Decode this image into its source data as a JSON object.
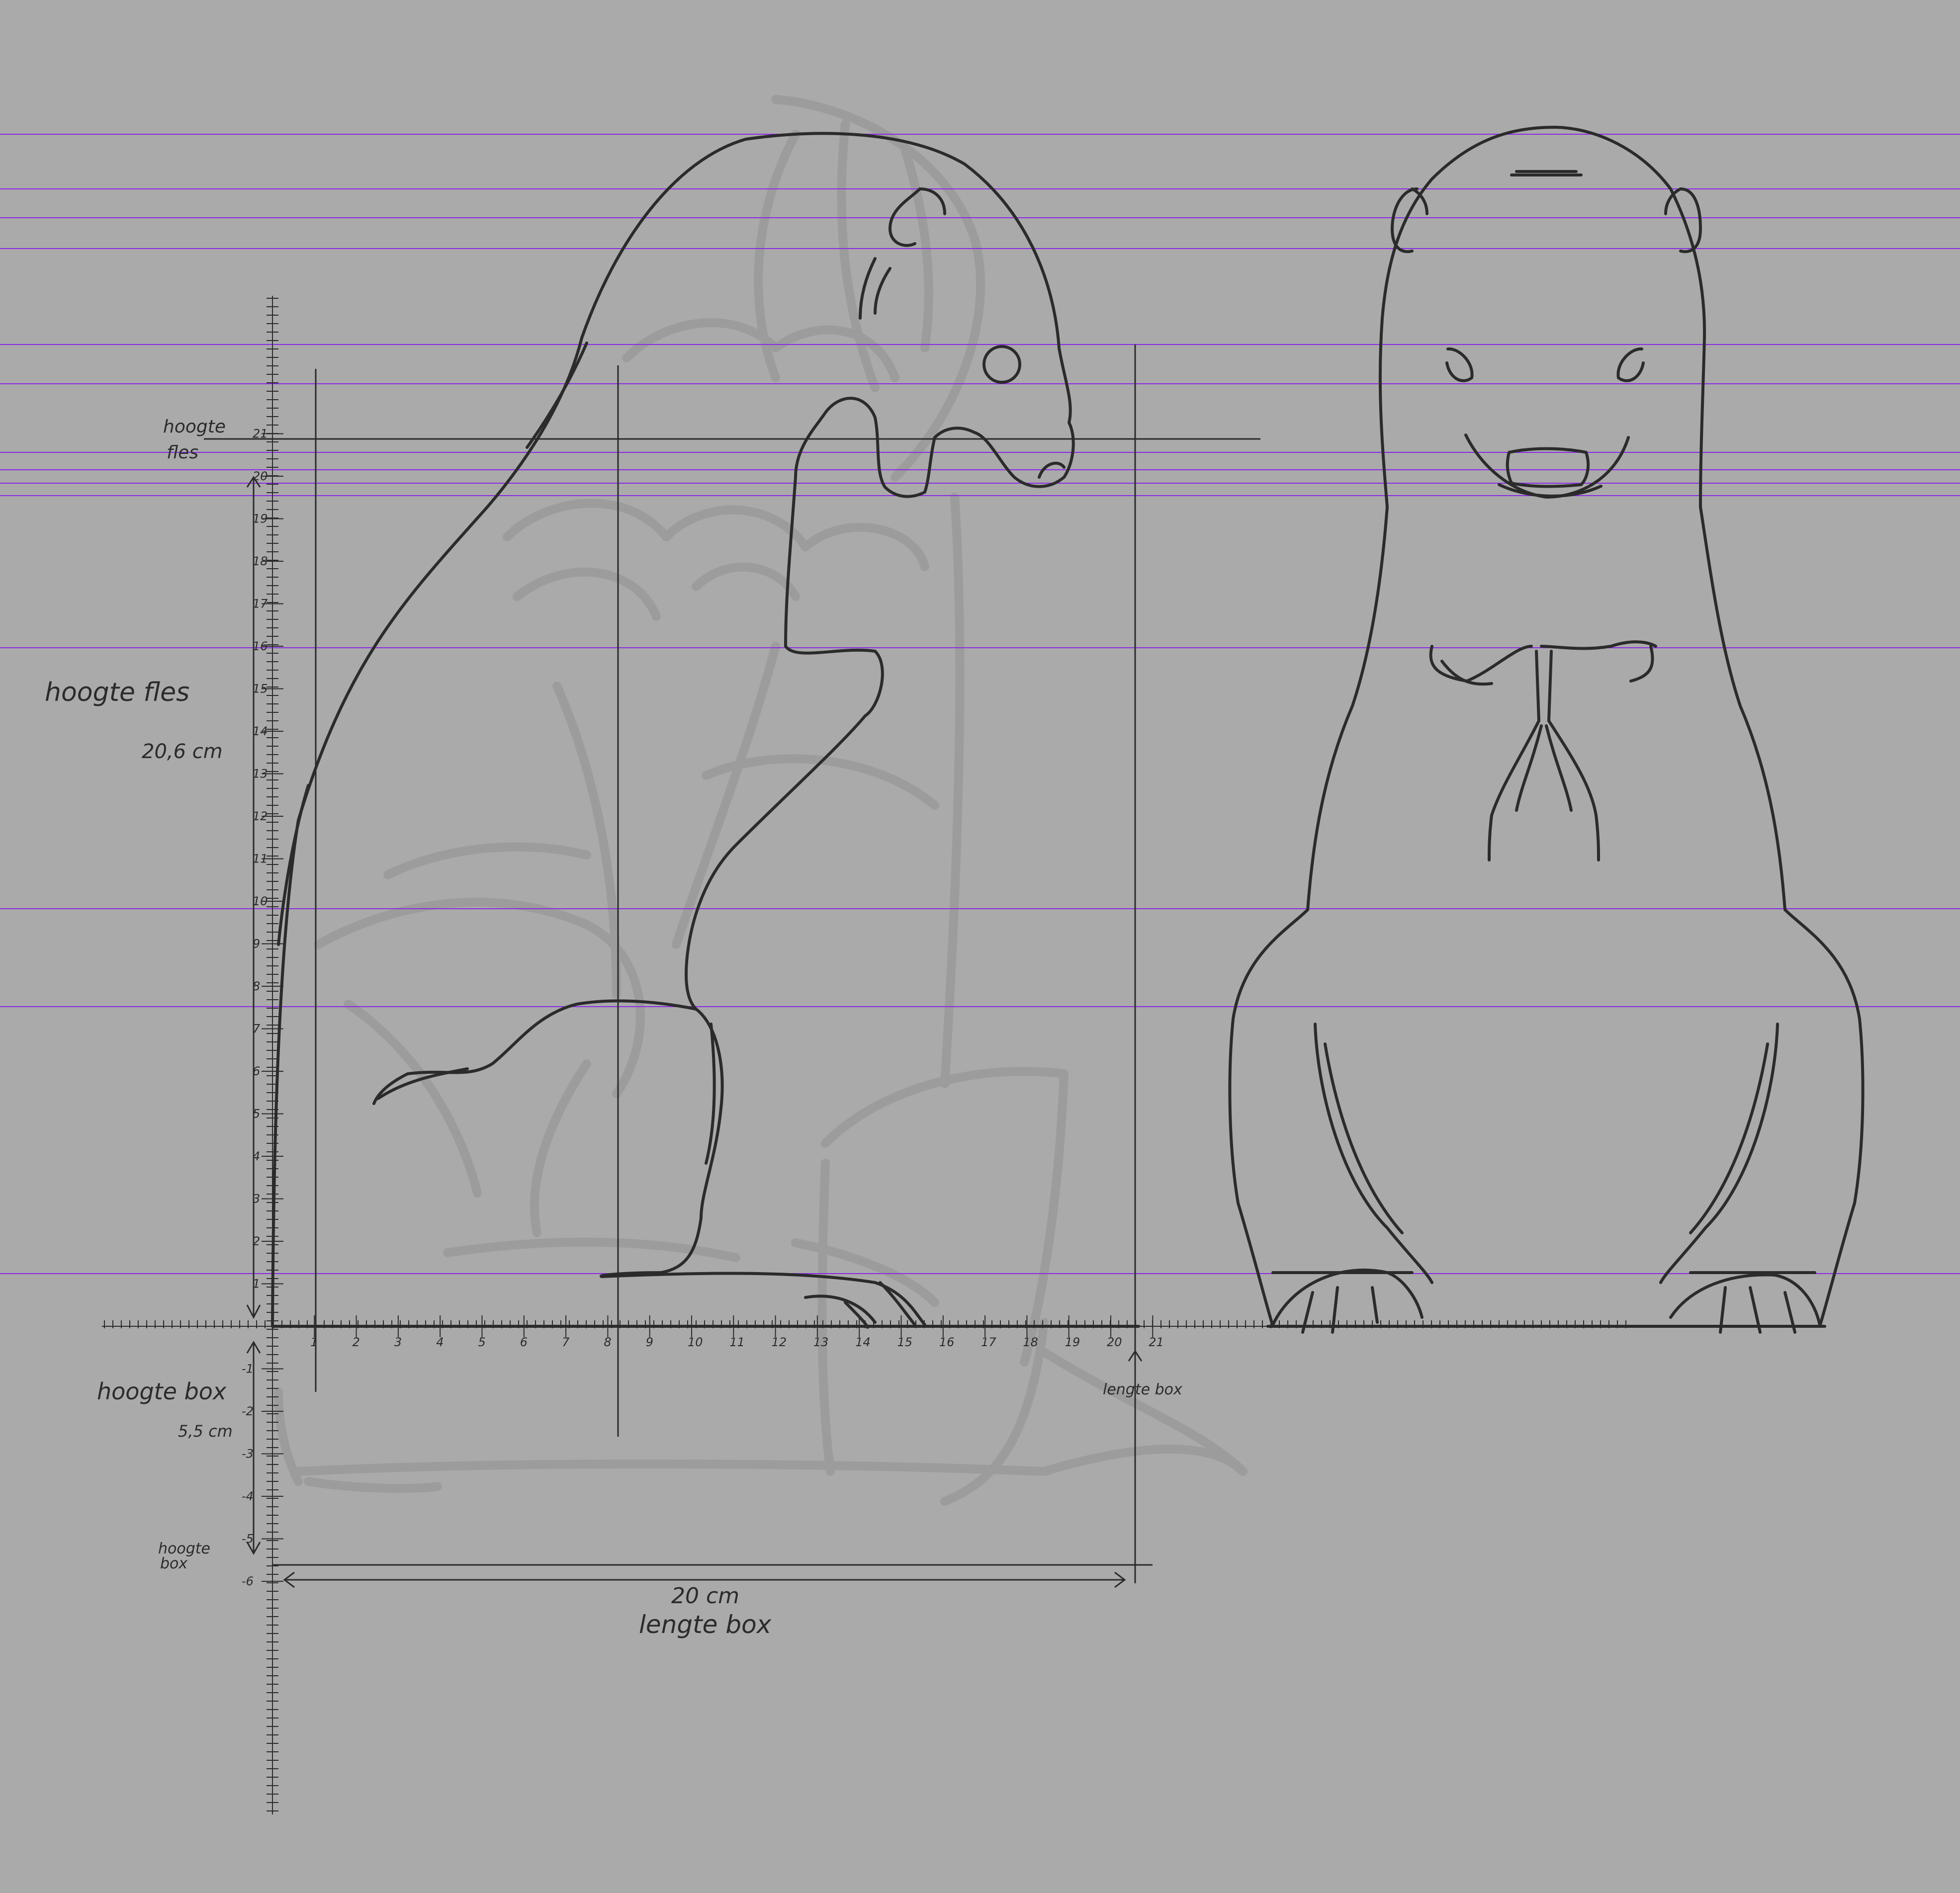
{
  "colors": {
    "background": "#aaaaaa",
    "guide_line": "#8a2be2",
    "ink": "#2b2b2b",
    "ghost_sketch": "#9a9a9a"
  },
  "labels": {
    "bottle_height_left": "hoogte fles",
    "bottle_height_value": "20,6 cm",
    "bottle_height_marker_line1": "hoogte",
    "bottle_height_marker_line2": "fles",
    "box_height": "hoogte box",
    "box_height_value": "5,5 cm",
    "box_height_marker_line1": "hoogte",
    "box_height_marker_line2": "box",
    "box_length_marker": "lengte box",
    "box_length_value": "20 cm",
    "box_length_label": "lengte box"
  },
  "ruler": {
    "unit": "cm",
    "vertical_ticks": [
      "21",
      "20",
      "19",
      "18",
      "17",
      "16",
      "15",
      "14",
      "13",
      "12",
      "11",
      "10",
      "9",
      "8",
      "7",
      "6",
      "5",
      "4",
      "3",
      "2",
      "1",
      "-1",
      "-2",
      "-3",
      "-4",
      "-5",
      "-6"
    ],
    "horizontal_ticks": [
      "1",
      "2",
      "3",
      "4",
      "5",
      "6",
      "7",
      "8",
      "9",
      "10",
      "11",
      "12",
      "13",
      "14",
      "15",
      "16",
      "17",
      "18",
      "19",
      "20",
      "21"
    ],
    "bottle_height_cm": 20.6,
    "box_height_cm": 5.5,
    "box_length_cm": 20
  }
}
